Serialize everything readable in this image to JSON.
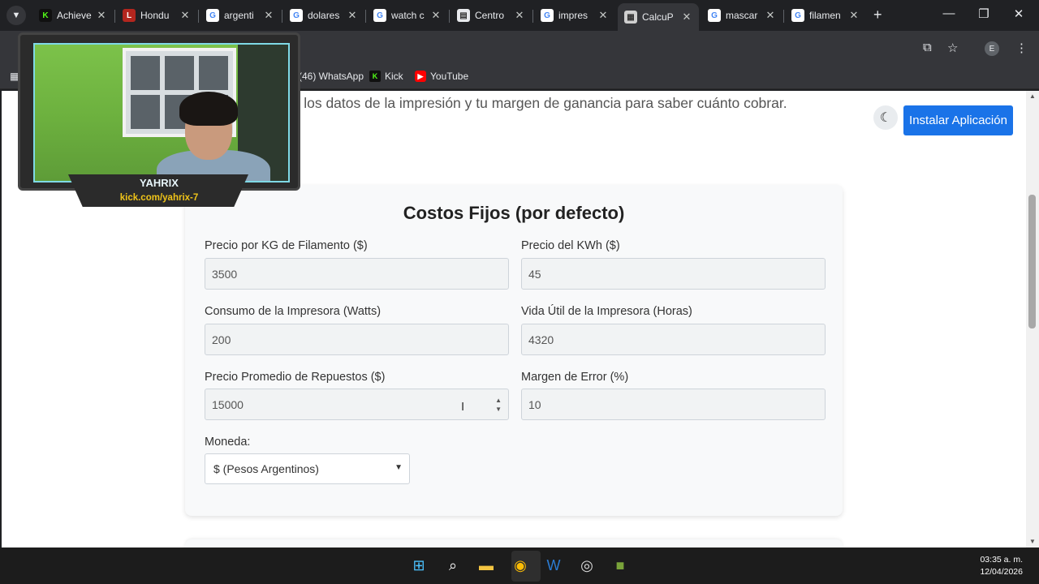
{
  "tabs": [
    {
      "title": "Achieve",
      "favicon": "kick-icon"
    },
    {
      "title": "Hondu",
      "favicon": "l-icon"
    },
    {
      "title": "argenti",
      "favicon": "google-icon"
    },
    {
      "title": "dolares",
      "favicon": "google-icon"
    },
    {
      "title": "watch c",
      "favicon": "google-icon"
    },
    {
      "title": "Centro",
      "favicon": "doc-icon"
    },
    {
      "title": "impres",
      "favicon": "google-icon"
    },
    {
      "title": "CalcuP",
      "favicon": "calc-icon"
    },
    {
      "title": "mascar",
      "favicon": "google-icon"
    },
    {
      "title": "filamen",
      "favicon": "google-icon"
    }
  ],
  "active_tab_index": 7,
  "profile_initial": "E",
  "bookmarks": [
    {
      "label": "(46) WhatsApp",
      "icon": "whatsapp-icon"
    },
    {
      "label": "Kick",
      "icon": "kick-icon"
    },
    {
      "label": "YouTube",
      "icon": "youtube-icon"
    }
  ],
  "page": {
    "intro_text": "stos fijos, los datos de la impresión y tu margen de ganancia para saber cuánto cobrar.",
    "install_button": "Instalar Aplicación",
    "card_title": "Costos Fijos (por defecto)",
    "fields": [
      {
        "label": "Precio por KG de Filamento ($)",
        "value": "3500"
      },
      {
        "label": "Precio del KWh ($)",
        "value": "45"
      },
      {
        "label": "Consumo de la Impresora (Watts)",
        "value": "200"
      },
      {
        "label": "Vida Útil de la Impresora (Horas)",
        "value": "4320"
      },
      {
        "label": "Precio Promedio de Repuestos ($)",
        "value": "15000"
      },
      {
        "label": "Margen de Error (%)",
        "value": "10"
      }
    ],
    "currency_label": "Moneda:",
    "currency_selected": "$ (Pesos Argentinos)"
  },
  "webcam": {
    "name": "YAHRIX",
    "link": "kick.com/yahrix-7"
  },
  "taskbar": {
    "time": "03:35 a. m.",
    "date": "12/04/2026"
  },
  "colors": {
    "install_button": "#1a73e8",
    "kick_green": "#53fc18",
    "webcam_link": "#f0c419"
  }
}
